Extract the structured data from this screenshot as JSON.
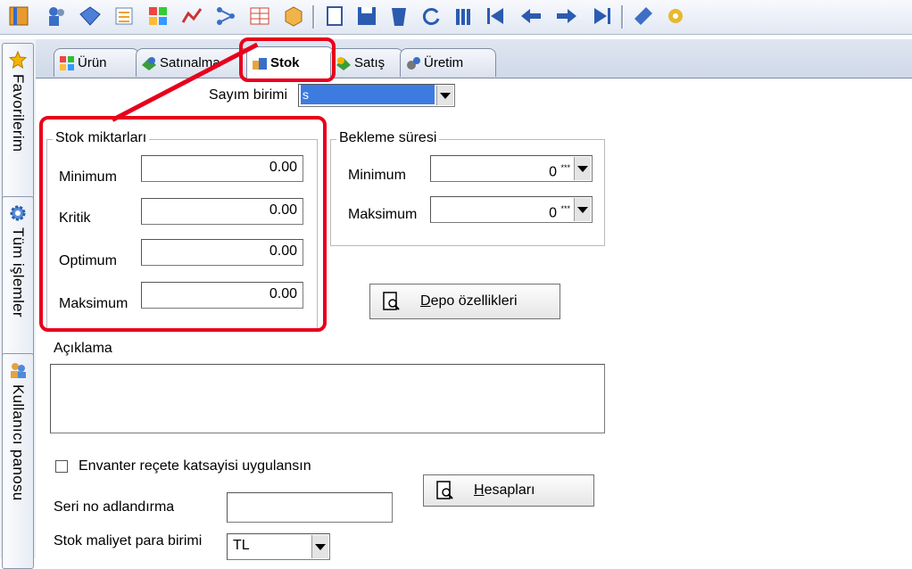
{
  "toolbar": {
    "icons": [
      "book-icon",
      "users-icon",
      "diamond-icon",
      "list-icon",
      "grid-icon",
      "chart-icon",
      "network-icon",
      "table-icon",
      "box-icon",
      "new-doc-icon",
      "save-icon",
      "delete-icon",
      "refresh-icon",
      "filter-icon",
      "first-icon",
      "prev-icon",
      "next-icon",
      "last-icon",
      "tools-icon",
      "settings-icon"
    ]
  },
  "sidebar": {
    "items": [
      {
        "label": "Favorilerim",
        "icon": "star-icon"
      },
      {
        "label": "Tüm işlemler",
        "icon": "gear-icon"
      },
      {
        "label": "Kullanıcı panosu",
        "icon": "users-icon"
      }
    ]
  },
  "tabs": [
    {
      "label": "Ürün",
      "icon": "product-icon"
    },
    {
      "label": "Satınalma",
      "icon": "purchase-icon"
    },
    {
      "label": "Stok",
      "icon": "stock-icon",
      "active": true
    },
    {
      "label": "Satış",
      "icon": "sales-icon"
    },
    {
      "label": "Üretim",
      "icon": "production-icon"
    }
  ],
  "form": {
    "count_unit_label": "Sayım birimi",
    "count_unit_value": "s",
    "stock_group": {
      "title": "Stok miktarları",
      "minimum_label": "Minimum",
      "minimum_value": "0.00",
      "critical_label": "Kritik",
      "critical_value": "0.00",
      "optimum_label": "Optimum",
      "optimum_value": "0.00",
      "maximum_label": "Maksimum",
      "maximum_value": "0.00"
    },
    "wait_group": {
      "title": "Bekleme süresi",
      "minimum_label": "Minimum",
      "minimum_value": "0",
      "maximum_label": "Maksimum",
      "maximum_value": "0",
      "unit_marker": "***"
    },
    "depot_button_underlined": "D",
    "depot_button_rest": "epo özellikleri",
    "description_label": "Açıklama",
    "description_value": "",
    "inventory_checkbox_label": "Envanter reçete katsayisi uygulansın",
    "inventory_checkbox_checked": false,
    "serial_label": "Seri no adlandırma",
    "serial_value": "",
    "accounts_button_underlined": "H",
    "accounts_button_rest": "esapları",
    "cost_currency_label": "Stok maliyet para birimi",
    "cost_currency_value": "TL"
  },
  "colors": {
    "highlight": "#e8001c",
    "accent": "#2a63c9"
  }
}
